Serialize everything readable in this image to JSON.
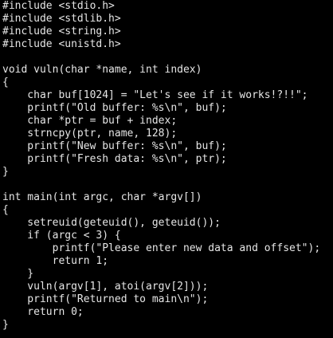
{
  "window": {
    "background_color": "#000000",
    "text_color": "#e6e6e6"
  },
  "code_lines": [
    "#include <stdio.h>",
    "#include <stdlib.h>",
    "#include <string.h>",
    "#include <unistd.h>",
    "",
    "void vuln(char *name, int index)",
    "{",
    "    char buf[1024] = \"Let's see if it works!?!!\";",
    "    printf(\"Old buffer: %s\\n\", buf);",
    "    char *ptr = buf + index;",
    "    strncpy(ptr, name, 128);",
    "    printf(\"New buffer: %s\\n\", buf);",
    "    printf(\"Fresh data: %s\\n\", ptr);",
    "}",
    "",
    "int main(int argc, char *argv[])",
    "{",
    "    setreuid(geteuid(), geteuid());",
    "    if (argc < 3) {",
    "        printf(\"Please enter new data and offset\");",
    "        return 1;",
    "    }",
    "    vuln(argv[1], atoi(argv[2]));",
    "    printf(\"Returned to main\\n\");",
    "    return 0;",
    "}"
  ]
}
